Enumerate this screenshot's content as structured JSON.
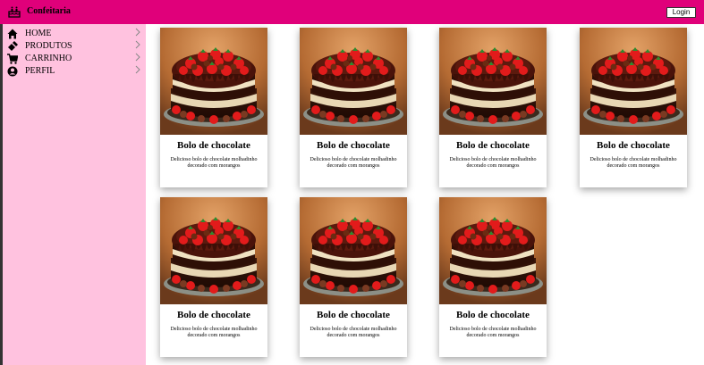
{
  "header": {
    "brand_icon": "cake-icon",
    "title": "Confeitaria",
    "login_label": "Login",
    "bar_color": "#e0007a"
  },
  "sidebar": {
    "background": "#ffc2df",
    "items": [
      {
        "label": "HOME",
        "icon": "home-icon"
      },
      {
        "label": "PRODUTOS",
        "icon": "products-icon"
      },
      {
        "label": "CARRINHO",
        "icon": "cart-icon"
      },
      {
        "label": "PERFIL",
        "icon": "profile-icon"
      }
    ]
  },
  "products": [
    {
      "title": "Bolo de chocolate",
      "description": "Delicioso bolo de chocolate molhadinho decorado com morangos"
    },
    {
      "title": "Bolo de chocolate",
      "description": "Delicioso bolo de chocolate molhadinho decorado com morangos"
    },
    {
      "title": "Bolo de chocolate",
      "description": "Delicioso bolo de chocolate molhadinho decorado com morangos"
    },
    {
      "title": "Bolo de chocolate",
      "description": "Delicioso bolo de chocolate molhadinho decorado com morangos"
    },
    {
      "title": "Bolo de chocolate",
      "description": "Delicioso bolo de chocolate molhadinho decorado com morangos"
    },
    {
      "title": "Bolo de chocolate",
      "description": "Delicioso bolo de chocolate molhadinho decorado com morangos"
    },
    {
      "title": "Bolo de chocolate",
      "description": "Delicioso bolo de chocolate molhadinho decorado com morangos"
    }
  ]
}
